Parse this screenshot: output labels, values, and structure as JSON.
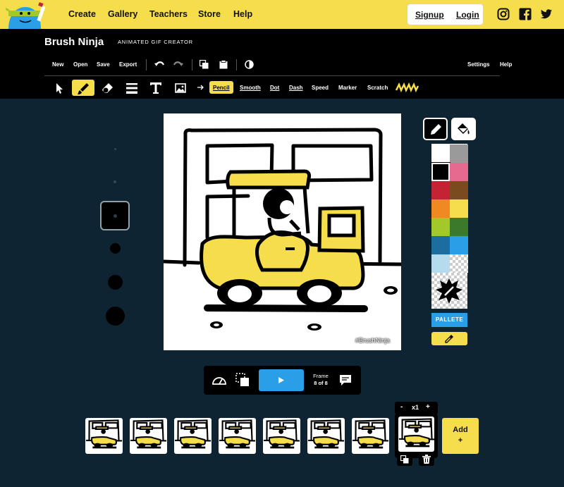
{
  "nav": {
    "links": [
      "Create",
      "Gallery",
      "Teachers",
      "Store",
      "Help"
    ],
    "signup": "Signup",
    "login": "Login",
    "social": [
      "instagram-icon",
      "facebook-icon",
      "twitter-icon"
    ]
  },
  "app": {
    "title": "Brush Ninja",
    "subtitle": "ANIMATED GIF CREATOR"
  },
  "menu": {
    "left": [
      "New",
      "Open",
      "Save",
      "Export"
    ],
    "settings": "Settings",
    "help": "Help"
  },
  "tools": [
    "select-tool-icon",
    "brush-tool-icon",
    "eraser-tool-icon",
    "lines-tool-icon",
    "text-tool-icon",
    "image-tool-icon"
  ],
  "brushes": {
    "items": [
      "Pencil",
      "Smooth",
      "Dot",
      "Dash",
      "Speed",
      "Marker",
      "Scratch"
    ],
    "active": "Pencil"
  },
  "canvas": {
    "watermark": "#BrushNinja"
  },
  "palette": {
    "colors": [
      "#ffffff",
      "#9a9a9a",
      "#000000",
      "#e66a8f",
      "#c22433",
      "#7a4b1f",
      "#ef8a23",
      "#f5dd4b",
      "#a3c829",
      "#3a7a2a",
      "#1c6ea0",
      "#2a9fe8",
      "#b5dbef",
      "transparent"
    ],
    "selected": "#000000",
    "pallete_label": "PALLETE"
  },
  "player": {
    "frame_label": "Frame",
    "frame_count": "8 of 8"
  },
  "frames": {
    "speed": "x1",
    "minus": "-",
    "plus": "+",
    "add_label": "Add",
    "add_plus": "+"
  },
  "colors": {
    "brand_yellow": "#f5dd4b",
    "accent_blue": "#2a9fe8",
    "background": "#0e2433"
  }
}
